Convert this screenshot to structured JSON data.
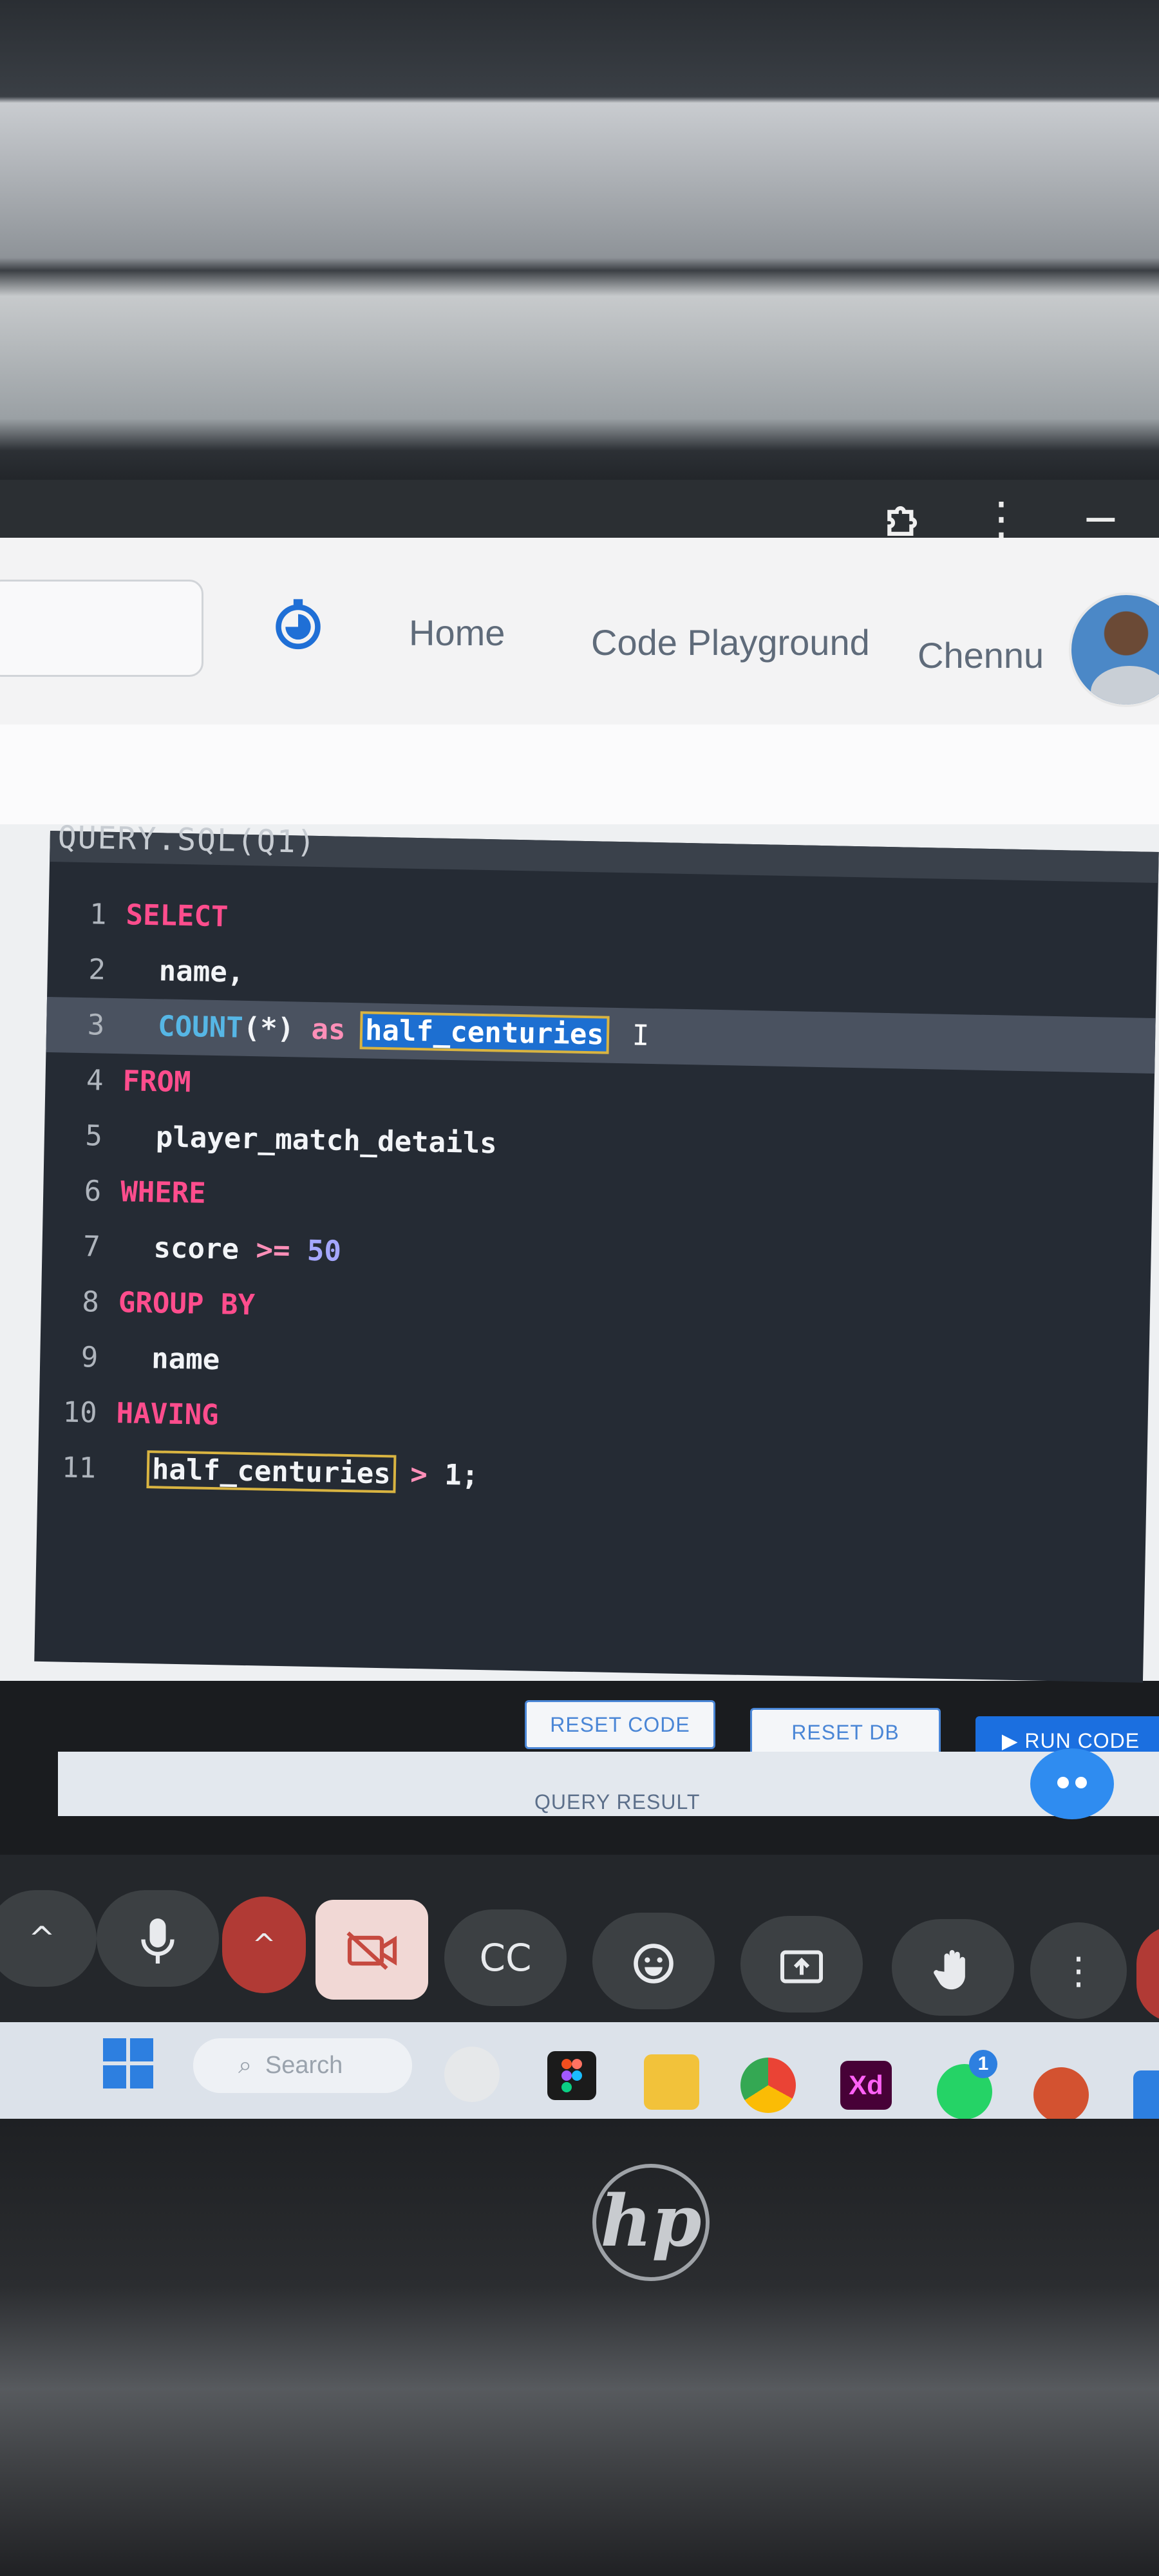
{
  "window_controls": {
    "extension_icon": "puzzle-icon",
    "menu_icon": "⋮",
    "minimize_icon": "−"
  },
  "header": {
    "search_placeholder": "",
    "timer_icon": "stopwatch-icon",
    "nav": {
      "home": "Home",
      "code_playground": "Code Playground",
      "user_name": "Chennu"
    }
  },
  "editor": {
    "title": "QUERY.SQL(Q1)",
    "lines": [
      {
        "no": "1",
        "parts": [
          {
            "t": "SELECT",
            "c": "kw"
          }
        ]
      },
      {
        "no": "2",
        "parts": [
          {
            "t": "  name,",
            "c": "id"
          }
        ]
      },
      {
        "no": "3",
        "parts": [
          {
            "t": "  COUNT",
            "c": "fn"
          },
          {
            "t": "(*)",
            "c": "id"
          },
          {
            "t": " as ",
            "c": "op"
          },
          {
            "t": "half_centuries",
            "c": "sel"
          }
        ]
      },
      {
        "no": "4",
        "parts": [
          {
            "t": "FROM",
            "c": "kw"
          }
        ]
      },
      {
        "no": "5",
        "parts": [
          {
            "t": "  player_match_details",
            "c": "id"
          }
        ]
      },
      {
        "no": "6",
        "parts": [
          {
            "t": "WHERE",
            "c": "kw"
          }
        ]
      },
      {
        "no": "7",
        "parts": [
          {
            "t": "  score ",
            "c": "id"
          },
          {
            "t": ">= ",
            "c": "op"
          },
          {
            "t": "50",
            "c": "num"
          }
        ]
      },
      {
        "no": "8",
        "parts": [
          {
            "t": "GROUP BY",
            "c": "kw"
          }
        ]
      },
      {
        "no": "9",
        "parts": [
          {
            "t": "  name",
            "c": "id"
          }
        ]
      },
      {
        "no": "10",
        "parts": [
          {
            "t": "HAVING",
            "c": "kw"
          }
        ]
      },
      {
        "no": "11",
        "parts": [
          {
            "t": "  ",
            "c": "id"
          },
          {
            "t": "half_centuries",
            "c": "match"
          },
          {
            "t": " > ",
            "c": "op"
          },
          {
            "t": "1;",
            "c": "id"
          }
        ]
      }
    ],
    "active_line": 3
  },
  "actions": {
    "reset_code": "RESET CODE",
    "reset_db": "RESET DB",
    "run_code": "▶ RUN CODE",
    "query_result": "QUERY RESULT"
  },
  "meeting_controls": {
    "chevron": "^",
    "mic_icon": "microphone-icon",
    "camera_off_icon": "camera-off-icon",
    "captions": "CC",
    "emoji_icon": "emoji-icon",
    "present_icon": "present-icon",
    "raise_hand_icon": "raise-hand-icon",
    "more": "⋮"
  },
  "taskbar": {
    "search_label": "Search",
    "xd_label": "Xd",
    "whatsapp_badge": "1"
  },
  "brand": {
    "laptop_logo": "hp"
  },
  "colors": {
    "editor_bg": "#252b34",
    "keyword": "#ff4d8d",
    "function": "#56b6e5",
    "selection": "#1d6fd1",
    "primary_button": "#1b6fe0"
  }
}
